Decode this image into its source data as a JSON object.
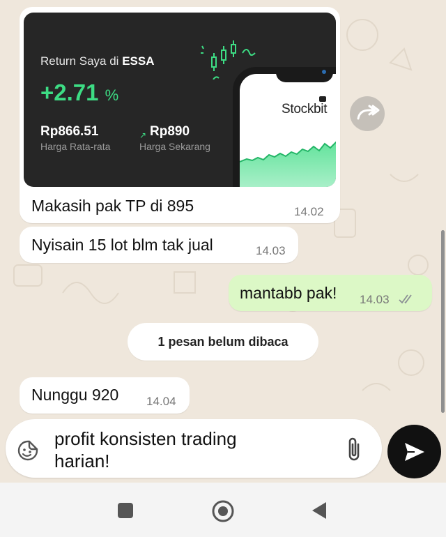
{
  "card": {
    "label_prefix": "Return Saya di",
    "ticker": "ESSA",
    "return_value": "+2.71",
    "return_unit": "%",
    "avg_price": "Rp866.51",
    "avg_price_label": "Harga Rata-rata",
    "current_price": "Rp890",
    "current_price_label": "Harga Sekarang",
    "brand": "Stockbit"
  },
  "messages": [
    {
      "text": "Makasih pak TP di 895",
      "time": "14.02",
      "direction": "in"
    },
    {
      "text": "Nyisain 15 lot blm tak jual",
      "time": "14.03",
      "direction": "in"
    },
    {
      "text": "mantabb pak!",
      "time": "14.03",
      "direction": "out",
      "status": "read"
    },
    {
      "text": "Nunggu 920",
      "time": "14.04",
      "direction": "in"
    }
  ],
  "unread_banner": "1 pesan belum dibaca",
  "composer": {
    "line1": "profit konsisten trading",
    "line2": "harian!"
  },
  "icons": {
    "forward": "forward-icon",
    "emoji": "sticker-icon",
    "attach": "paperclip-icon",
    "send": "send-icon",
    "read_receipt": "double-check-icon"
  },
  "colors": {
    "accent_green": "#3ddc84",
    "outgoing_bubble": "#dcf8c6",
    "read_tick": "#8a8f94"
  }
}
